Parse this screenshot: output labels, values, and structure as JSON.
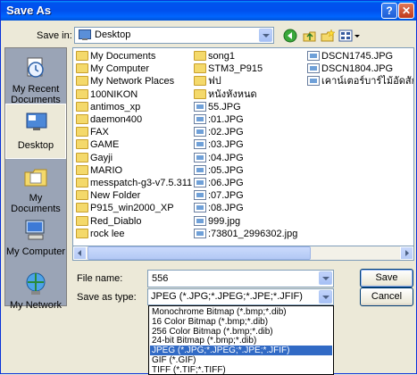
{
  "window": {
    "title": "Save As",
    "help_label": "?",
    "close_label": "✕"
  },
  "save_in": {
    "label": "Save in:",
    "value": "Desktop"
  },
  "places": [
    {
      "label": "My Recent Documents",
      "icon": "recent-documents-icon"
    },
    {
      "label": "Desktop",
      "icon": "desktop-icon"
    },
    {
      "label": "My Documents",
      "icon": "my-documents-icon"
    },
    {
      "label": "My Computer",
      "icon": "my-computer-icon"
    },
    {
      "label": "My Network",
      "icon": "my-network-icon"
    }
  ],
  "files": {
    "col1": [
      {
        "name": "My Documents",
        "icon": "my-documents-icon"
      },
      {
        "name": "My Computer",
        "icon": "my-computer-icon"
      },
      {
        "name": "My Network Places",
        "icon": "network-places-icon"
      },
      {
        "name": "100NIKON",
        "icon": "folder-icon"
      },
      {
        "name": "antimos_xp",
        "icon": "folder-icon"
      },
      {
        "name": "daemon400",
        "icon": "folder-icon"
      },
      {
        "name": "FAX",
        "icon": "folder-icon"
      },
      {
        "name": "GAME",
        "icon": "folder-icon"
      },
      {
        "name": "Gayji",
        "icon": "folder-icon"
      },
      {
        "name": "MARIO",
        "icon": "folder-icon"
      },
      {
        "name": "messpatch-g3-v7.5.311",
        "icon": "folder-icon"
      },
      {
        "name": "New Folder",
        "icon": "folder-icon"
      },
      {
        "name": "P915_win2000_XP",
        "icon": "folder-icon"
      },
      {
        "name": "Red_Diablo",
        "icon": "folder-icon"
      },
      {
        "name": "rock lee",
        "icon": "folder-icon"
      }
    ],
    "col2": [
      {
        "name": "song1",
        "icon": "folder-icon"
      },
      {
        "name": "STM3_P915",
        "icon": "folder-icon"
      },
      {
        "name": "ฟป",
        "icon": "folder-icon"
      },
      {
        "name": "หนังหังหนด",
        "icon": "folder-icon"
      },
      {
        "name": "55.JPG",
        "icon": "image-file-icon"
      },
      {
        "name": ":01.JPG",
        "icon": "image-file-icon"
      },
      {
        "name": ":02.JPG",
        "icon": "image-file-icon"
      },
      {
        "name": ":03.JPG",
        "icon": "image-file-icon"
      },
      {
        "name": ":04.JPG",
        "icon": "image-file-icon"
      },
      {
        "name": ":05.JPG",
        "icon": "image-file-icon"
      },
      {
        "name": ":06.JPG",
        "icon": "image-file-icon"
      },
      {
        "name": ":07.JPG",
        "icon": "image-file-icon"
      },
      {
        "name": ":08.JPG",
        "icon": "image-file-icon"
      },
      {
        "name": "999.jpg",
        "icon": "image-file-icon"
      },
      {
        "name": ":73801_2996302.jpg",
        "icon": "image-file-icon"
      }
    ],
    "col3": [
      {
        "name": "DSCN1745.JPG",
        "icon": "image-file-icon"
      },
      {
        "name": "DSCN1804.JPG",
        "icon": "image-file-icon"
      },
      {
        "name": "เคาน์เตอร์บาร์ไม้อัดสัก.JP",
        "icon": "image-file-icon"
      }
    ]
  },
  "file_name": {
    "label": "File name:",
    "value": "556"
  },
  "save_as_type": {
    "label": "Save as type:",
    "value": "JPEG (*.JPG;*.JPEG;*.JPE;*.JFIF)"
  },
  "buttons": {
    "save": "Save",
    "cancel": "Cancel"
  },
  "type_options": [
    "Monochrome Bitmap (*.bmp;*.dib)",
    "16 Color Bitmap (*.bmp;*.dib)",
    "256 Color Bitmap (*.bmp;*.dib)",
    "24-bit Bitmap (*.bmp;*.dib)",
    "JPEG (*.JPG;*.JPEG;*.JPE;*.JFIF)",
    "GIF (*.GIF)",
    "TIFF (*.TIF;*.TIFF)"
  ],
  "selected_type_index": 4,
  "colors": {
    "titlebar": "#0053ee",
    "selection": "#316ac5",
    "dialog_bg": "#ece9d8"
  }
}
